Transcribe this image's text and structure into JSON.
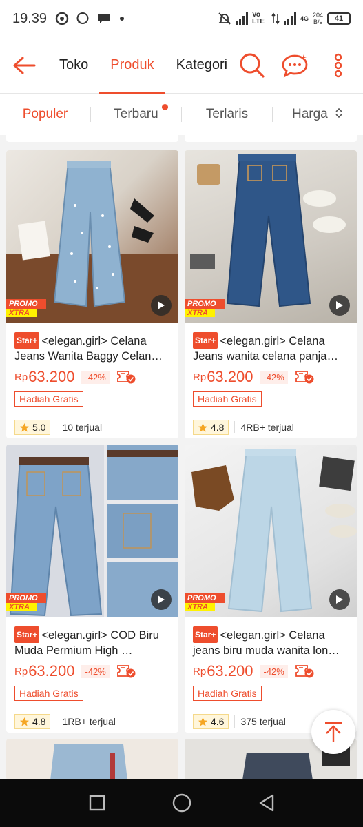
{
  "status_bar": {
    "time": "19.39",
    "network_type": "Vo LTE",
    "network_gen": "4G",
    "data_rate": "204",
    "data_unit": "B/s",
    "battery": "41"
  },
  "header": {
    "tabs": [
      {
        "label": "Toko",
        "active": false
      },
      {
        "label": "Produk",
        "active": true
      },
      {
        "label": "Kategori",
        "active": false
      }
    ]
  },
  "sort": {
    "items": [
      {
        "label": "Populer",
        "active": true
      },
      {
        "label": "Terbaru",
        "active": false
      },
      {
        "label": "Terlaris",
        "active": false
      },
      {
        "label": "Harga",
        "active": false
      }
    ]
  },
  "products": [
    {
      "badge": "Star+",
      "title": "<elegan.girl> Celana Jeans Wanita Baggy Celan…",
      "currency": "Rp",
      "price": "63.200",
      "discount": "-42%",
      "gift": "Hadiah Gratis",
      "rating": "5.0",
      "sold": "10 terjual",
      "promo_top": "PROMO",
      "promo_bottom": "XTRA"
    },
    {
      "badge": "Star+",
      "title": "<elegan.girl> Celana Jeans wanita celana panja…",
      "currency": "Rp",
      "price": "63.200",
      "discount": "-42%",
      "gift": "Hadiah Gratis",
      "rating": "4.8",
      "sold": "4RB+ terjual",
      "promo_top": "PROMO",
      "promo_bottom": "XTRA"
    },
    {
      "badge": "Star+",
      "title": "<elegan.girl> COD Biru Muda Permium High …",
      "currency": "Rp",
      "price": "63.200",
      "discount": "-42%",
      "gift": "Hadiah Gratis",
      "rating": "4.8",
      "sold": "1RB+ terjual",
      "promo_top": "PROMO",
      "promo_bottom": "XTRA"
    },
    {
      "badge": "Star+",
      "title": "<elegan.girl> Celana jeans biru muda wanita lon…",
      "currency": "Rp",
      "price": "63.200",
      "discount": "-42%",
      "gift": "Hadiah Gratis",
      "rating": "4.6",
      "sold": "375 terjual",
      "promo_top": "PROMO",
      "promo_bottom": "XTRA"
    }
  ],
  "colors": {
    "accent": "#ee4d2d",
    "promo_yellow": "#fff200",
    "star": "#f5a623"
  },
  "icons": [
    "back-arrow-icon",
    "search-icon",
    "chat-icon",
    "more-vertical-icon",
    "play-icon",
    "cod-icon",
    "star-icon",
    "scroll-top-icon",
    "recent-apps-icon",
    "home-icon",
    "back-nav-icon"
  ]
}
